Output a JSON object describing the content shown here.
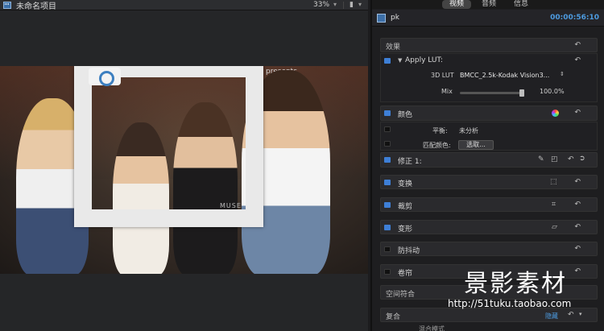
{
  "viewer": {
    "project_title": "未命名项目",
    "zoom": "33%",
    "frame_sign_text": "presents",
    "frame_brand": "MUSE"
  },
  "inspector": {
    "tabs": [
      {
        "label": "视频",
        "active": true
      },
      {
        "label": "音频",
        "active": false
      },
      {
        "label": "信息",
        "active": false
      }
    ],
    "clip_name": "pk",
    "timecode": "00:00:56:10",
    "effects_header": "效果",
    "apply_lut": {
      "label": "Apply LUT:",
      "lut_label": "3D LUT",
      "lut_value": "BMCC_2.5k-Kodak Vision3...",
      "mix_label": "Mix",
      "mix_value": "100.0",
      "mix_unit": "%",
      "mix_level": 1.0
    },
    "color": {
      "label": "颜色",
      "balance_label": "平衡:",
      "balance_value": "未分析",
      "match_label": "匹配颜色:",
      "match_button": "选取..."
    },
    "correction": {
      "label": "修正 1:"
    },
    "sections": [
      {
        "label": "变换",
        "enabled": true
      },
      {
        "label": "裁剪",
        "enabled": true
      },
      {
        "label": "变形",
        "enabled": true
      },
      {
        "label": "防抖动",
        "enabled": false
      },
      {
        "label": "卷帘",
        "enabled": false
      }
    ],
    "spatial_header": "空间符合",
    "composite_header": "复合",
    "hide_label": "隐藏",
    "composite_sub": "混合模式"
  },
  "watermark": {
    "text": "景影素材",
    "url": "http://51tuku.taobao.com"
  },
  "colors": {
    "accent_blue": "#3e7fd6",
    "timecode_blue": "#4d9be0"
  }
}
